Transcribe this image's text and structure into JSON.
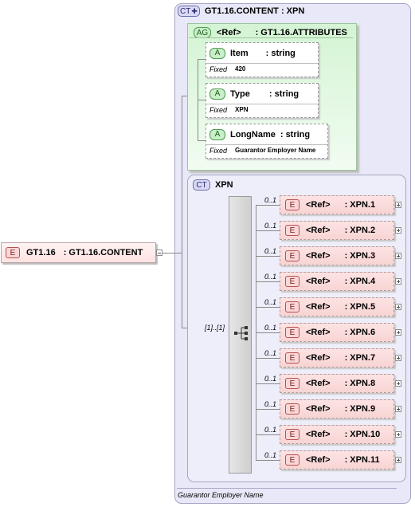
{
  "root_element": {
    "badge": "E",
    "name": "GT1.16",
    "type": ": GT1.16.CONTENT"
  },
  "content_type": {
    "badge": "CT",
    "title": "GT1.16.CONTENT : XPN"
  },
  "attribute_group": {
    "badge": "AG",
    "ref": "<Ref>",
    "type": ": GT1.16.ATTRIBUTES"
  },
  "attributes": [
    {
      "badge": "A",
      "name": "Item",
      "type": ": string",
      "fixed_label": "Fixed",
      "fixed_value": "420"
    },
    {
      "badge": "A",
      "name": "Type",
      "type": ": string",
      "fixed_label": "Fixed",
      "fixed_value": "XPN"
    },
    {
      "badge": "A",
      "name": "LongName",
      "type": ": string",
      "fixed_label": "Fixed",
      "fixed_value": "Guarantor Employer Name"
    }
  ],
  "inner_type": {
    "badge": "CT",
    "title": "XPN"
  },
  "sequence_occurrence": "[1]..[1]",
  "children": [
    {
      "occurrence": "0..1",
      "badge": "E",
      "ref": "<Ref>",
      "type": ": XPN.1"
    },
    {
      "occurrence": "0..1",
      "badge": "E",
      "ref": "<Ref>",
      "type": ": XPN.2"
    },
    {
      "occurrence": "0..1",
      "badge": "E",
      "ref": "<Ref>",
      "type": ": XPN.3"
    },
    {
      "occurrence": "0..1",
      "badge": "E",
      "ref": "<Ref>",
      "type": ": XPN.4"
    },
    {
      "occurrence": "0..1",
      "badge": "E",
      "ref": "<Ref>",
      "type": ": XPN.5"
    },
    {
      "occurrence": "0..1",
      "badge": "E",
      "ref": "<Ref>",
      "type": ": XPN.6"
    },
    {
      "occurrence": "0..1",
      "badge": "E",
      "ref": "<Ref>",
      "type": ": XPN.7"
    },
    {
      "occurrence": "0..1",
      "badge": "E",
      "ref": "<Ref>",
      "type": ": XPN.8"
    },
    {
      "occurrence": "0..1",
      "badge": "E",
      "ref": "<Ref>",
      "type": ": XPN.9"
    },
    {
      "occurrence": "0..1",
      "badge": "E",
      "ref": "<Ref>",
      "type": ": XPN.10"
    },
    {
      "occurrence": "0..1",
      "badge": "E",
      "ref": "<Ref>",
      "type": ": XPN.11"
    }
  ],
  "annotation": "Guarantor Employer Name"
}
